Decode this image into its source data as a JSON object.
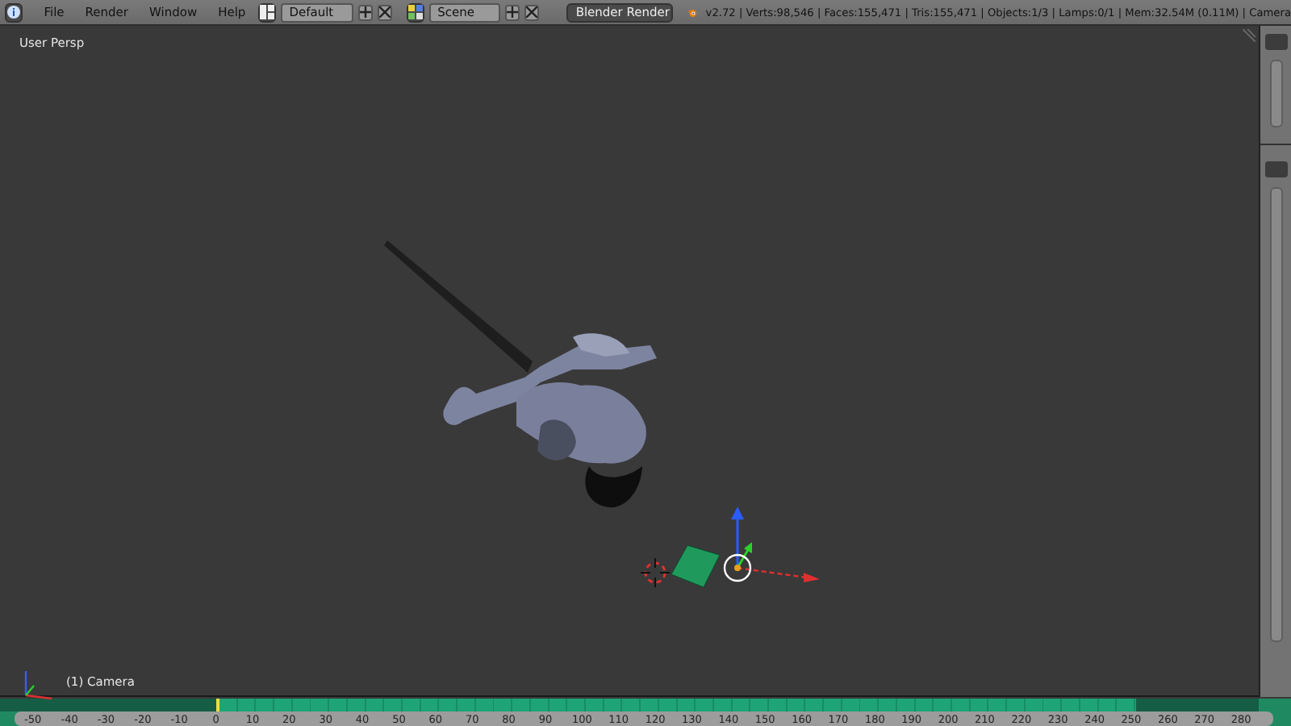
{
  "header": {
    "menus": [
      "File",
      "Render",
      "Window",
      "Help"
    ],
    "layout": {
      "value": "Default"
    },
    "scene": {
      "value": "Scene"
    },
    "render_engine": {
      "value": "Blender Render"
    },
    "stats": "v2.72 | Verts:98,546 | Faces:155,471 | Tris:155,471 | Objects:1/3 | Lamps:0/1 | Mem:32.54M (0.11M) | Camera"
  },
  "viewport": {
    "view_label": "User Persp",
    "object_label": "(1) Camera"
  },
  "timeline": {
    "ticks": [
      "-50",
      "-40",
      "-30",
      "-20",
      "-10",
      "0",
      "10",
      "20",
      "30",
      "40",
      "50",
      "60",
      "70",
      "80",
      "90",
      "100",
      "110",
      "120",
      "130",
      "140",
      "150",
      "160",
      "170",
      "180",
      "190",
      "200",
      "210",
      "220",
      "230",
      "240",
      "250",
      "260",
      "270",
      "280"
    ]
  }
}
